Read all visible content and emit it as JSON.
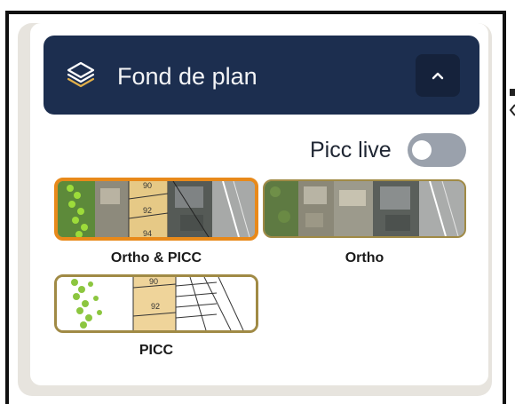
{
  "panel": {
    "header": {
      "title": "Fond de plan",
      "icon": "layers-icon",
      "toggle_icon": "chevron-up-icon",
      "colors": {
        "header_bg": "#1c2e4f",
        "icon_accent": "#e2b04a"
      }
    },
    "picc_live": {
      "label": "Picc live",
      "enabled": false
    },
    "basemaps": [
      {
        "label": "Ortho & PICC",
        "selected": true,
        "parcel_numbers": [
          "90",
          "92",
          "94"
        ]
      },
      {
        "label": "Ortho",
        "selected": false,
        "parcel_numbers": []
      },
      {
        "label": "PICC",
        "selected": false,
        "parcel_numbers": [
          "90",
          "92"
        ]
      }
    ],
    "colors": {
      "selected_border": "#e8891a",
      "unselected_border": "#a08a45"
    }
  }
}
